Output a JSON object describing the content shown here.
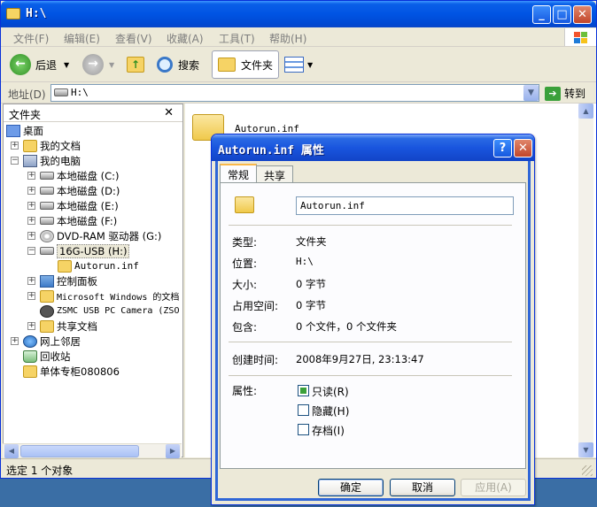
{
  "window": {
    "title": "H:\\",
    "menu": [
      "文件(F)",
      "编辑(E)",
      "查看(V)",
      "收藏(A)",
      "工具(T)",
      "帮助(H)"
    ],
    "toolbar": {
      "back": "后退",
      "search": "搜索",
      "folders": "文件夹"
    },
    "address": {
      "label": "地址(D)",
      "value": "H:\\",
      "go": "转到"
    },
    "status": "选定 1 个对象"
  },
  "tree": {
    "header": "文件夹",
    "items": [
      {
        "label": "桌面"
      },
      {
        "label": "我的文档"
      },
      {
        "label": "我的电脑"
      },
      {
        "label": "本地磁盘 (C:)"
      },
      {
        "label": "本地磁盘 (D:)"
      },
      {
        "label": "本地磁盘 (E:)"
      },
      {
        "label": "本地磁盘 (F:)"
      },
      {
        "label": "DVD-RAM 驱动器 (G:)"
      },
      {
        "label": "16G-USB (H:)"
      },
      {
        "label": "Autorun.inf"
      },
      {
        "label": "控制面板"
      },
      {
        "label": "Microsoft Windows 的文档"
      },
      {
        "label": "ZSMC USB PC Camera (ZSO"
      },
      {
        "label": "共享文档"
      },
      {
        "label": "网上邻居"
      },
      {
        "label": "回收站"
      },
      {
        "label": "单体专柜080806"
      }
    ]
  },
  "content": {
    "item": "Autorun.inf"
  },
  "dialog": {
    "title": "Autorun.inf 属性",
    "tabs": [
      "常规",
      "共享"
    ],
    "name": "Autorun.inf",
    "props": [
      {
        "label": "类型:",
        "value": "文件夹"
      },
      {
        "label": "位置:",
        "value": "H:\\"
      },
      {
        "label": "大小:",
        "value": "0 字节"
      },
      {
        "label": "占用空间:",
        "value": "0 字节"
      },
      {
        "label": "包含:",
        "value": "0 个文件，0 个文件夹"
      }
    ],
    "created_label": "创建时间:",
    "created_value": "2008年9月27日, 23:13:47",
    "attr_label": "属性:",
    "attrs": [
      {
        "label": "只读(R)",
        "checked": true
      },
      {
        "label": "隐藏(H)",
        "checked": false
      },
      {
        "label": "存档(I)",
        "checked": false
      }
    ],
    "buttons": {
      "ok": "确定",
      "cancel": "取消",
      "apply": "应用(A)"
    }
  }
}
